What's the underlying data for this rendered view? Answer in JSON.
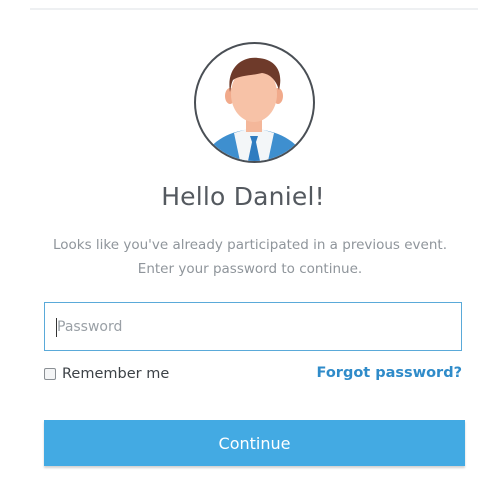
{
  "colors": {
    "accent": "#43aae3",
    "link": "#2f8bc9",
    "field_border": "#5aaad9"
  },
  "avatar": {
    "icon": "user-avatar-icon"
  },
  "greeting": "Hello Daniel!",
  "message": "Looks like you've already participated in a previous event. Enter your password to continue.",
  "password": {
    "placeholder": "Password",
    "value": ""
  },
  "remember": {
    "label": "Remember me",
    "checked": false
  },
  "forgot_label": "Forgot password?",
  "continue_label": "Continue"
}
